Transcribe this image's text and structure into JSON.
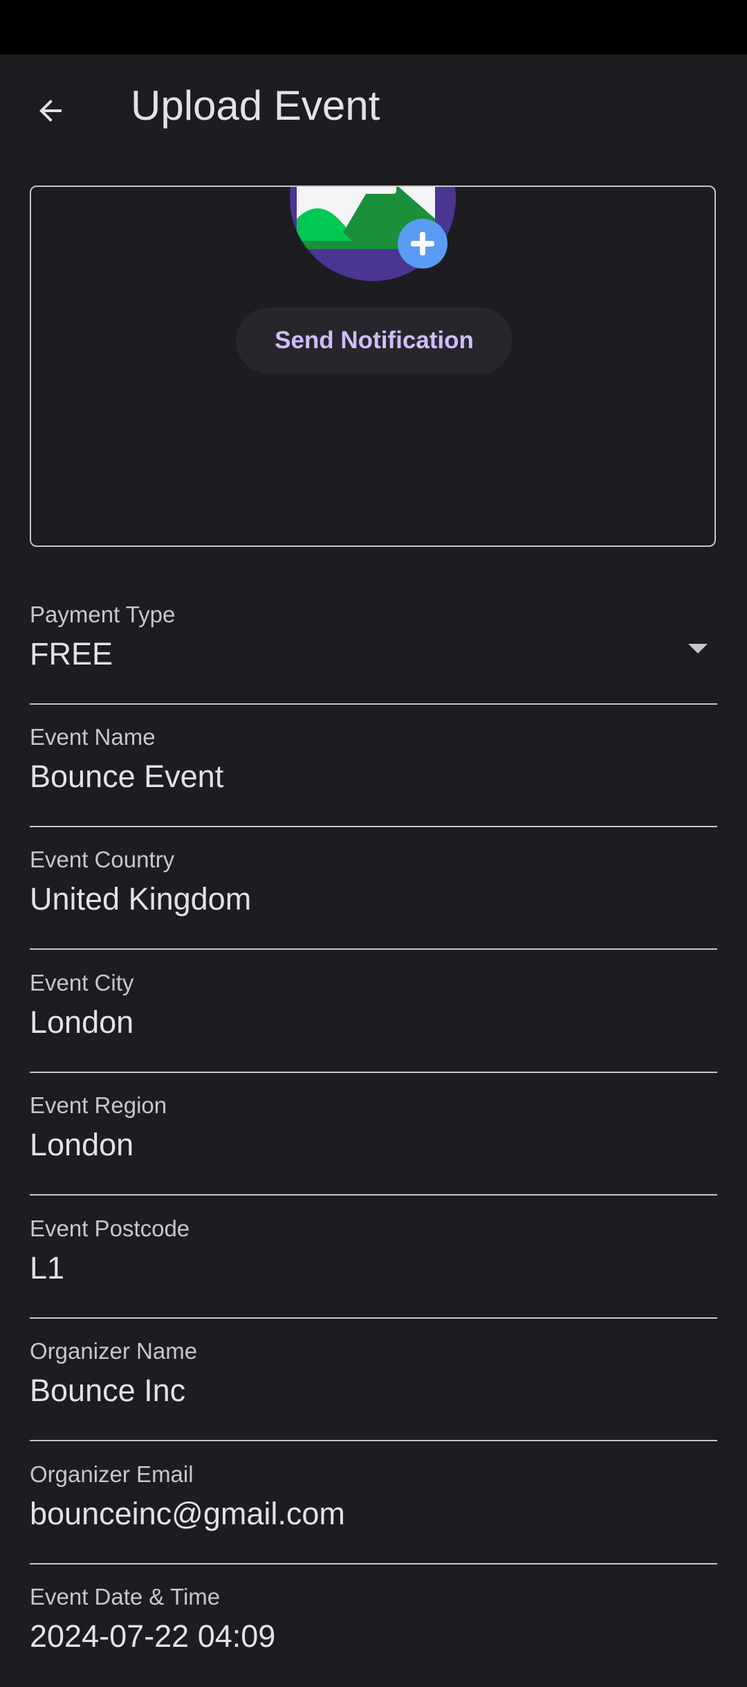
{
  "header": {
    "title": "Upload Event",
    "back_icon": "arrow-back-icon"
  },
  "image_picker": {
    "icon": "add-image-icon",
    "send_button_label": "Send Notification"
  },
  "form": {
    "payment_type": {
      "label": "Payment Type",
      "value": "FREE"
    },
    "event_name": {
      "label": "Event Name",
      "value": "Bounce Event"
    },
    "event_country": {
      "label": "Event Country",
      "value": "United Kingdom"
    },
    "event_city": {
      "label": "Event City",
      "value": "London"
    },
    "event_region": {
      "label": "Event Region",
      "value": "London"
    },
    "event_postcode": {
      "label": "Event Postcode",
      "value": "L1"
    },
    "organizer_name": {
      "label": "Organizer Name",
      "value": "Bounce Inc"
    },
    "organizer_email": {
      "label": "Organizer Email",
      "value": "bounceinc@gmail.com"
    },
    "event_datetime": {
      "label": "Event Date & Time",
      "value": "2024-07-22 04:09"
    }
  },
  "colors": {
    "background": "#1d1c21",
    "accent": "#d1bcff",
    "divider": "#c9c5ca"
  }
}
